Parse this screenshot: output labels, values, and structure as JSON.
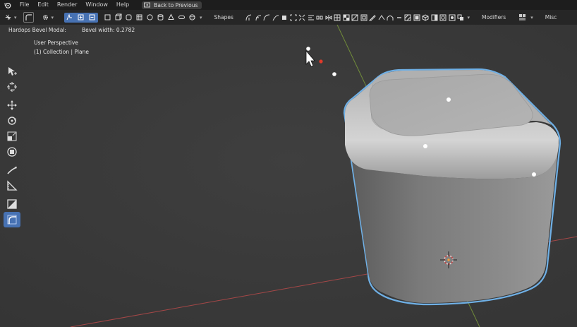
{
  "menubar": {
    "items": [
      "File",
      "Edit",
      "Render",
      "Window",
      "Help"
    ],
    "back_button": "Back to Previous"
  },
  "header": {
    "shapes_label": "Shapes",
    "modifiers_label": "Modifiers",
    "misc_label": "Misc"
  },
  "viewport": {
    "modal_name": "Hardops Bevel Modal:",
    "bevel_width": "Bevel width: 0.2782",
    "view_name": "User Perspective",
    "collection": "(1) Collection | Plane"
  },
  "colors": {
    "accent": "#4772b3",
    "selection_outline": "#6fb0e6",
    "x_axis": "#b84a4a",
    "y_axis": "#7a9a3a",
    "active_dot": "#e03a2a"
  }
}
